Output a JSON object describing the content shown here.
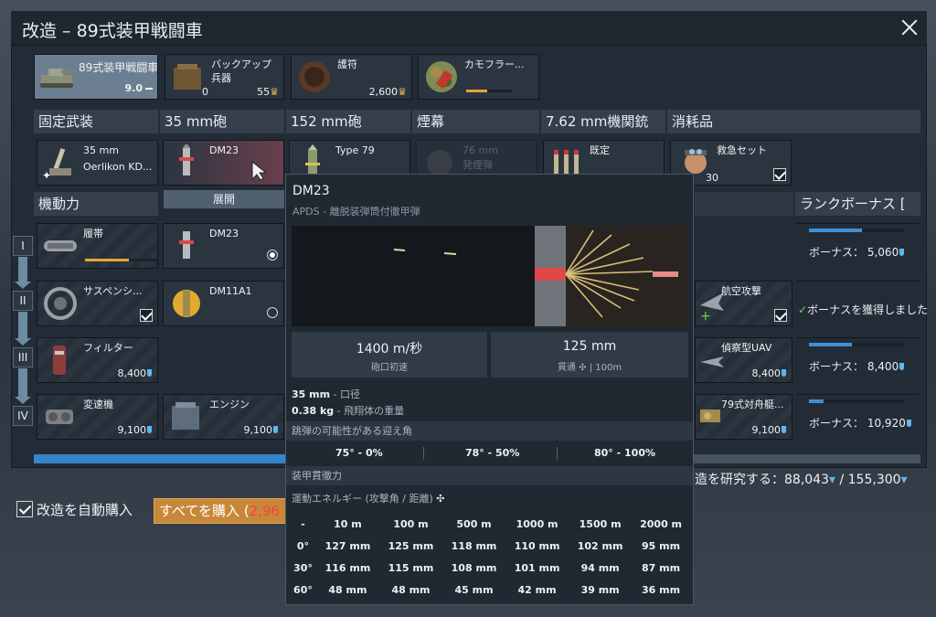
{
  "window": {
    "title": "改造 – 89式装甲戦闘車"
  },
  "top_items": [
    {
      "name": "89式装甲戦闘車",
      "value": "9.0"
    },
    {
      "name": "バックアップ",
      "line2": "兵器",
      "count": "0",
      "cost": "55"
    },
    {
      "name": "護符",
      "cost": "2,600"
    },
    {
      "name": "カモフラー...",
      "progress": 0.45
    }
  ],
  "category_headers": [
    "固定武装",
    "35 mm砲",
    "152 mm砲",
    "煙幕",
    "7.62 mm機関銃",
    "消耗品"
  ],
  "weapons": [
    {
      "name": "35 mm",
      "line2": "Oerlikon KD..."
    },
    {
      "name": "DM23"
    },
    {
      "name": "Type 79"
    },
    {
      "name": "76 mm",
      "line2": "発煙弾"
    },
    {
      "name": "既定"
    },
    {
      "name": "救急セット",
      "count": "30"
    }
  ],
  "mobility_header": "機動力",
  "expand_label": "展開",
  "rank_bonus_header": "ランクボーナス [",
  "tiers": [
    "I",
    "II",
    "III",
    "IV"
  ],
  "mobility": [
    {
      "name": "履帯",
      "progress": 0.6
    },
    {
      "name": "サスペンシ...",
      "checked": true
    },
    {
      "name": "フィルター",
      "cost": "8,400"
    },
    {
      "name": "変速機",
      "cost": "9,100"
    }
  ],
  "ammo_list": [
    {
      "name": "DM23",
      "selected": true
    },
    {
      "name": "DM11A1",
      "selected": false
    }
  ],
  "engine": {
    "name": "エンジン",
    "cost": "9,100"
  },
  "right_items": [
    {
      "name": "航空攻撃",
      "checked": true
    },
    {
      "name": "偵察型UAV",
      "cost": "8,400"
    },
    {
      "name": "79式対舟艇...",
      "cost": "9,100"
    }
  ],
  "bonuses": [
    {
      "text": "ボーナス：",
      "value": "5,060",
      "progress": 0.55
    },
    {
      "text": "ボーナスを獲得しました"
    },
    {
      "text": "ボーナス：",
      "value": "8,400",
      "progress": 0.45
    },
    {
      "text": "ボーナス：",
      "value": "10,920",
      "progress": 0.15
    }
  ],
  "tooltip": {
    "title": "DM23",
    "subtitle": "APDS - 離脱装弾筒付徹甲弾",
    "stat_velocity": "1400 m/秒",
    "stat_velocity_label": "砲口初速",
    "stat_pen": "125 mm",
    "stat_pen_label": "貫通",
    "stat_pen_dist": "| 100m",
    "caliber_value": "35 mm",
    "caliber_label": "- 口径",
    "mass_value": "0.38 kg",
    "mass_label": "- 飛翔体の重量",
    "ricochet_title": "跳弾の可能性がある迎え角",
    "ricochet": [
      "75° - 0%",
      "78° - 50%",
      "80° - 100%"
    ],
    "armor_title": "装甲貫徹力",
    "energy_label": "運動エネルギー (攻撃角 / 距離)",
    "table_header": [
      "-",
      "10 m",
      "100 m",
      "500 m",
      "1000 m",
      "1500 m",
      "2000 m"
    ],
    "table_rows": [
      [
        "0°",
        "127 mm",
        "125 mm",
        "118 mm",
        "110 mm",
        "102 mm",
        "95 mm"
      ],
      [
        "30°",
        "116 mm",
        "115 mm",
        "108 mm",
        "101 mm",
        "94 mm",
        "87 mm"
      ],
      [
        "60°",
        "48 mm",
        "48 mm",
        "45 mm",
        "42 mm",
        "39 mm",
        "36 mm"
      ]
    ]
  },
  "research_text": "造を研究する：88,043",
  "research_total": " / 155,300",
  "autobuy_label": "改造を自動購入",
  "buyall_label": "すべてを購入 (",
  "buyall_cost": "2,96"
}
